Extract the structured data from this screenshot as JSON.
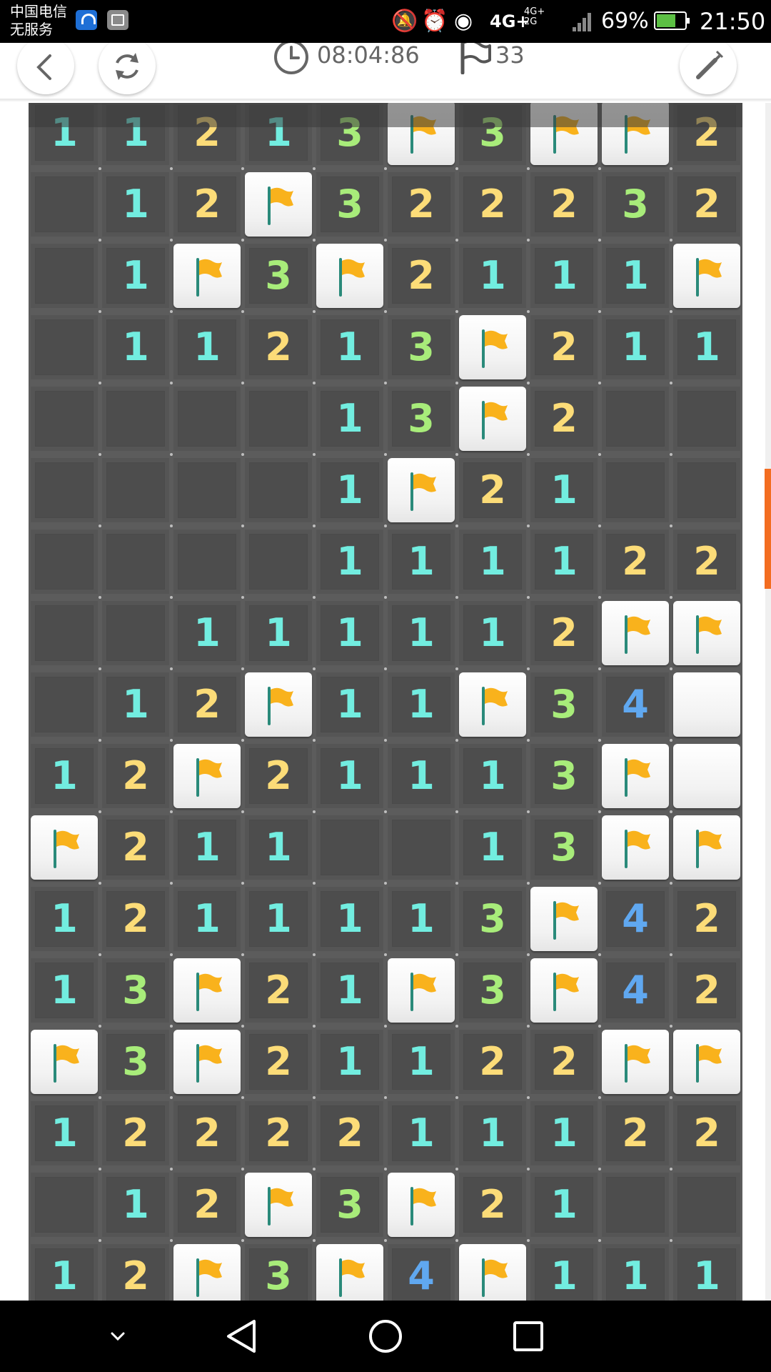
{
  "status_bar": {
    "carrier_line1": "中国电信",
    "carrier_line2": "无服务",
    "network": "4G+",
    "network_secondary": "4G+\n2G",
    "battery_percent": "69%",
    "battery_level": 0.69,
    "time": "21:50"
  },
  "header": {
    "timer": "08:04:86",
    "flag_count": "33",
    "icons": [
      "back-arrow-icon",
      "restart-icon",
      "clock-icon",
      "flag-icon",
      "magic-wand-icon"
    ]
  },
  "board": {
    "columns": 10,
    "legend": "digits = revealed number, F = flagged tile, U = unrevealed tile, E = empty revealed tile",
    "rows": [
      [
        "1",
        "1",
        "2",
        "1",
        "3",
        "F",
        "3",
        "F",
        "F",
        "2"
      ],
      [
        "E",
        "1",
        "2",
        "F",
        "3",
        "2",
        "2",
        "2",
        "3",
        "2"
      ],
      [
        "E",
        "1",
        "F",
        "3",
        "F",
        "2",
        "1",
        "1",
        "1",
        "F"
      ],
      [
        "E",
        "1",
        "1",
        "2",
        "1",
        "3",
        "F",
        "2",
        "1",
        "1"
      ],
      [
        "E",
        "E",
        "E",
        "E",
        "1",
        "3",
        "F",
        "2",
        "E",
        "E"
      ],
      [
        "E",
        "E",
        "E",
        "E",
        "1",
        "F",
        "2",
        "1",
        "E",
        "E"
      ],
      [
        "E",
        "E",
        "E",
        "E",
        "1",
        "1",
        "1",
        "1",
        "2",
        "2"
      ],
      [
        "E",
        "E",
        "1",
        "1",
        "1",
        "1",
        "1",
        "2",
        "F",
        "F"
      ],
      [
        "E",
        "1",
        "2",
        "F",
        "1",
        "1",
        "F",
        "3",
        "4",
        "U"
      ],
      [
        "1",
        "2",
        "F",
        "2",
        "1",
        "1",
        "1",
        "3",
        "F",
        "U"
      ],
      [
        "F",
        "2",
        "1",
        "1",
        "E",
        "E",
        "1",
        "3",
        "F",
        "F"
      ],
      [
        "1",
        "2",
        "1",
        "1",
        "1",
        "1",
        "3",
        "F",
        "4",
        "2"
      ],
      [
        "1",
        "3",
        "F",
        "2",
        "1",
        "F",
        "3",
        "F",
        "4",
        "2"
      ],
      [
        "F",
        "3",
        "F",
        "2",
        "1",
        "1",
        "2",
        "2",
        "F",
        "F"
      ],
      [
        "1",
        "2",
        "2",
        "2",
        "2",
        "1",
        "1",
        "1",
        "2",
        "2"
      ],
      [
        "E",
        "1",
        "2",
        "F",
        "3",
        "F",
        "2",
        "1",
        "E",
        "E"
      ],
      [
        "1",
        "2",
        "F",
        "3",
        "F",
        "4",
        "F",
        "1",
        "1",
        "1"
      ]
    ],
    "number_colors": {
      "1": "#72ede0",
      "2": "#fcdc78",
      "3": "#a8ec7a",
      "4": "#60a8f0"
    },
    "flag_color": "#f9b21c",
    "pole_color": "#2a8a7a"
  },
  "navigation": {
    "icons": [
      "chevron-down-icon",
      "back-triangle-icon",
      "home-circle-icon",
      "recent-square-icon"
    ]
  },
  "accent_color": "#f36d21"
}
